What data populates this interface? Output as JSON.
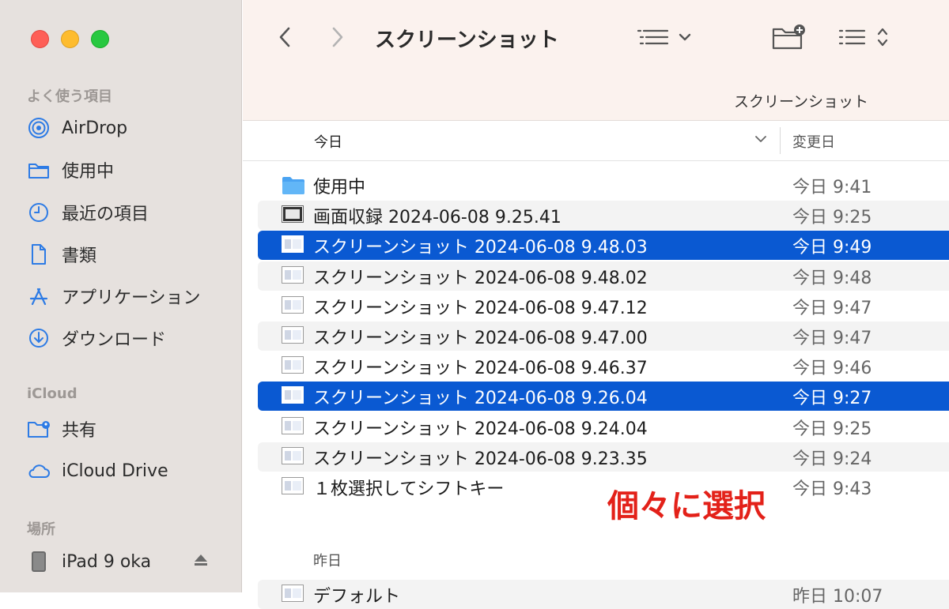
{
  "window": {
    "title": "スクリーンショット",
    "path_label": "スクリーンショット"
  },
  "toolbar": {
    "back_icon": "chevron-left-icon",
    "forward_icon": "chevron-right-icon",
    "view_icon": "list-view-icon",
    "new_folder_icon": "folder-plus-icon",
    "sort_icon": "list-sort-icon"
  },
  "sidebar": {
    "favorites_title": "よく使う項目",
    "favorites": [
      {
        "label": "AirDrop",
        "icon": "airdrop-icon"
      },
      {
        "label": "使用中",
        "icon": "folder-icon"
      },
      {
        "label": "最近の項目",
        "icon": "clock-icon"
      },
      {
        "label": "書類",
        "icon": "document-icon"
      },
      {
        "label": "アプリケーション",
        "icon": "applications-icon"
      },
      {
        "label": "ダウンロード",
        "icon": "download-icon"
      }
    ],
    "icloud_title": "iCloud",
    "icloud": [
      {
        "label": "共有",
        "icon": "shared-folder-icon"
      },
      {
        "label": "iCloud Drive",
        "icon": "cloud-icon"
      }
    ],
    "locations_title": "場所",
    "locations": [
      {
        "label": "iPad 9 oka",
        "icon": "ipad-icon"
      }
    ]
  },
  "columns": {
    "name": "今日",
    "date": "変更日"
  },
  "files": [
    {
      "name": "使用中",
      "date": "今日 9:41",
      "icon": "folder-icon",
      "state": "normal"
    },
    {
      "name": "画面収録 2024-06-08 9.25.41",
      "date": "今日 9:25",
      "icon": "movie-thumbnail-icon",
      "state": "alt"
    },
    {
      "name": "スクリーンショット 2024-06-08 9.48.03",
      "date": "今日 9:49",
      "icon": "image-thumbnail-icon",
      "state": "selected"
    },
    {
      "name": "スクリーンショット 2024-06-08 9.48.02",
      "date": "今日 9:48",
      "icon": "image-thumbnail-icon",
      "state": "alt"
    },
    {
      "name": "スクリーンショット 2024-06-08 9.47.12",
      "date": "今日 9:47",
      "icon": "image-thumbnail-icon",
      "state": "normal"
    },
    {
      "name": "スクリーンショット 2024-06-08 9.47.00",
      "date": "今日 9:47",
      "icon": "image-thumbnail-icon",
      "state": "alt"
    },
    {
      "name": "スクリーンショット 2024-06-08 9.46.37",
      "date": "今日 9:46",
      "icon": "image-thumbnail-icon",
      "state": "normal"
    },
    {
      "name": "スクリーンショット 2024-06-08 9.26.04",
      "date": "今日 9:27",
      "icon": "image-thumbnail-icon",
      "state": "selected"
    },
    {
      "name": "スクリーンショット 2024-06-08 9.24.04",
      "date": "今日 9:25",
      "icon": "image-thumbnail-icon",
      "state": "normal"
    },
    {
      "name": "スクリーンショット 2024-06-08 9.23.35",
      "date": "今日 9:24",
      "icon": "image-thumbnail-icon",
      "state": "alt"
    },
    {
      "name": "１枚選択してシフトキー",
      "date": "今日 9:43",
      "icon": "image-thumbnail-icon",
      "state": "normal"
    }
  ],
  "group2_title": "昨日",
  "cut_file": {
    "name": "デフォルト",
    "date": "昨日 10:07"
  },
  "annotation": "個々に選択",
  "colors": {
    "selection": "#0a59d2",
    "annotation": "#e32119",
    "accent_icon": "#2d7be5"
  }
}
